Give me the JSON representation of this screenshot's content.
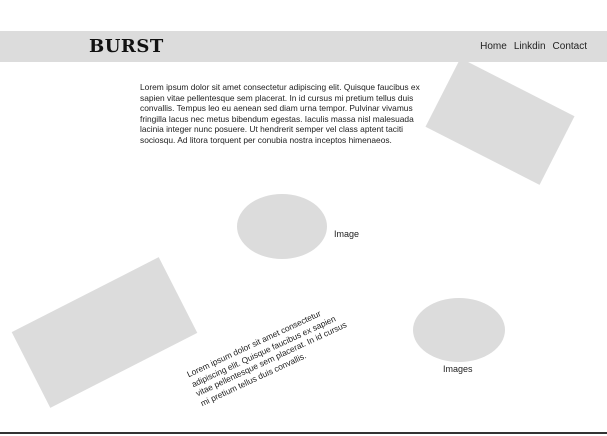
{
  "colors": {
    "navbar_bg": "#dcdcdc",
    "placeholder_shape": "#dcdcdc",
    "text": "#222222",
    "bottom_border": "#333333"
  },
  "header": {
    "logo": "BURST",
    "nav": [
      "Home",
      "Linkdin",
      "Contact"
    ]
  },
  "main": {
    "paragraph": "Lorem ipsum dolor sit amet consectetur adipiscing elit. Quisque faucibus ex sapien vitae pellentesque sem placerat. In id cursus mi pretium tellus duis convallis. Tempus leo eu aenean sed diam urna tempor. Pulvinar vivamus fringilla lacus nec metus bibendum egestas. Iaculis massa nisl malesuada lacinia integer nunc posuere. Ut hendrerit semper vel class aptent taciti sociosqu. Ad litora torquent per conubia nostra inceptos himenaeos.",
    "image_caption": "Image",
    "images_caption": "Images",
    "rotated_paragraph": "Lorem ipsum dolor sit amet consectetur adipiscing elit. Quisque faucibus ex sapien vitae pellentesque sem placerat. In id cursus mi pretium tellus duis convallis."
  }
}
